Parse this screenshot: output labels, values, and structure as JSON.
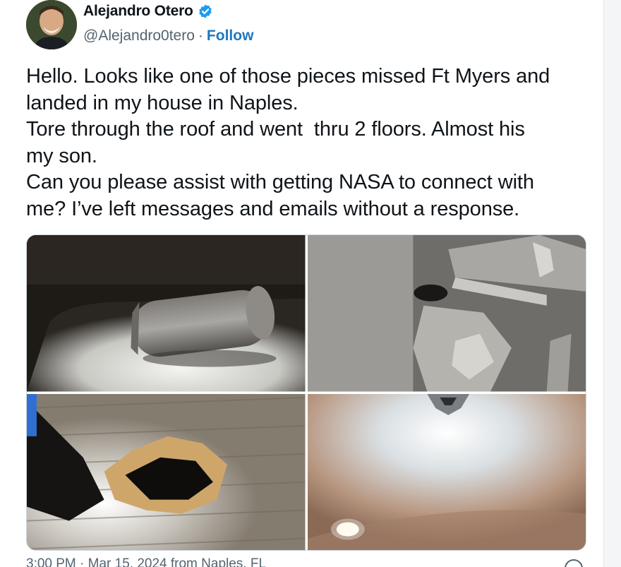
{
  "author": {
    "display_name": "Alejandro Otero",
    "handle": "@Alejandro0tero",
    "separator": "·",
    "follow_label": "Follow",
    "verified_icon": "verified-badge-icon",
    "verified_color": "#1d9bf0"
  },
  "tweet": {
    "text": "Hello. Looks like one of those pieces missed Ft Myers and\nlanded in my house in Naples.\nTore through the roof and went  thru 2 floors. Almost his\nmy son.\nCan you please assist with getting NASA to connect with\nme? I’ve left messages and emails without a response."
  },
  "media": {
    "photos": [
      {
        "name": "photo-debris-cylinder"
      },
      {
        "name": "photo-roof-hole"
      },
      {
        "name": "photo-floor-hole"
      },
      {
        "name": "photo-ceiling-hole"
      }
    ]
  },
  "footer": {
    "timestamp": "3:00 PM · Mar 15, 2024 from Naples, FL"
  },
  "colors": {
    "link": "#1d77c2",
    "muted": "#536471",
    "text": "#0f1419"
  }
}
